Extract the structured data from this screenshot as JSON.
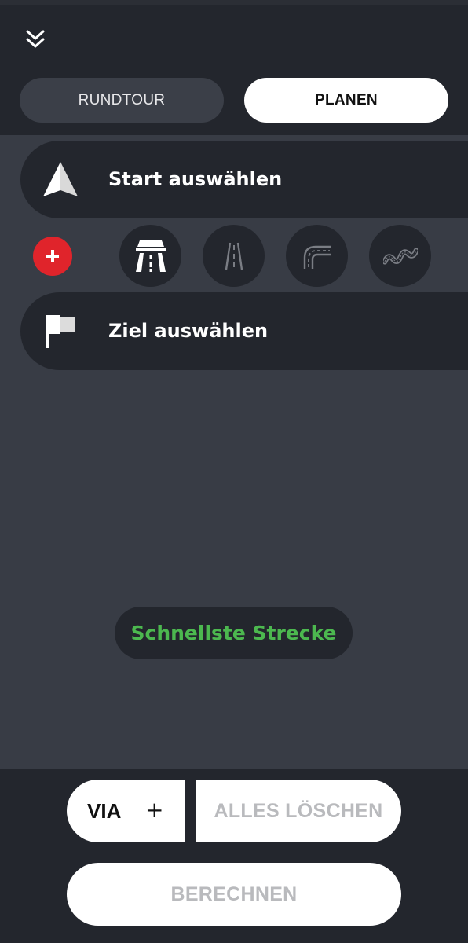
{
  "header": {
    "collapse_icon": "double-chevron-down-icon",
    "tabs": [
      {
        "label": "RUNDTOUR",
        "active": false
      },
      {
        "label": "PLANEN",
        "active": true
      }
    ]
  },
  "waypoints": {
    "start": {
      "label": "Start auswählen",
      "icon": "navigation-arrow-icon"
    },
    "destination": {
      "label": "Ziel auswählen",
      "icon": "flag-icon"
    }
  },
  "route_types": {
    "add_icon": "plus-icon",
    "items": [
      {
        "icon": "highway-icon",
        "selected": true
      },
      {
        "icon": "road-icon",
        "selected": false
      },
      {
        "icon": "curvy-road-icon",
        "selected": false
      },
      {
        "icon": "winding-road-icon",
        "selected": false
      }
    ]
  },
  "strategy": {
    "label": "Schnellste Strecke",
    "color": "#4cb84f"
  },
  "actions": {
    "via_label": "VIA",
    "via_plus": "+",
    "clear_label": "ALLES LÖSCHEN",
    "calculate_label": "BERECHNEN"
  },
  "colors": {
    "background": "#383c45",
    "panel": "#23262d",
    "accent_red": "#e0242b",
    "accent_green": "#4cb84f",
    "disabled_text": "#b9babd"
  }
}
